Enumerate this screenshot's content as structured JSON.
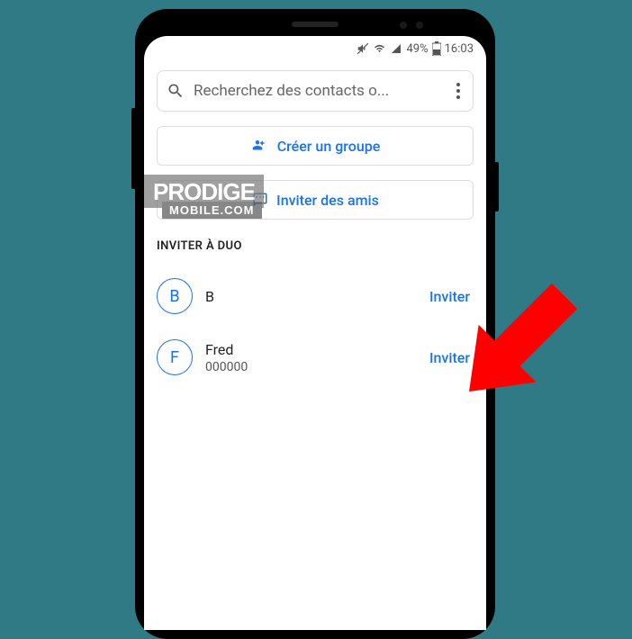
{
  "status_bar": {
    "battery_pct": "49%",
    "time": "16:03"
  },
  "search": {
    "placeholder": "Recherchez des contacts o..."
  },
  "actions": {
    "create_group": "Créer un groupe",
    "invite_friends": "Inviter des amis"
  },
  "section_header": "INVITER À DUO",
  "contacts": [
    {
      "initial": "B",
      "name": "B",
      "sub": "",
      "action": "Inviter"
    },
    {
      "initial": "F",
      "name": "Fred",
      "sub": "000000",
      "action": "Inviter"
    }
  ],
  "watermark": {
    "top": "PRODIGE",
    "bottom": "MOBILE.COM"
  }
}
